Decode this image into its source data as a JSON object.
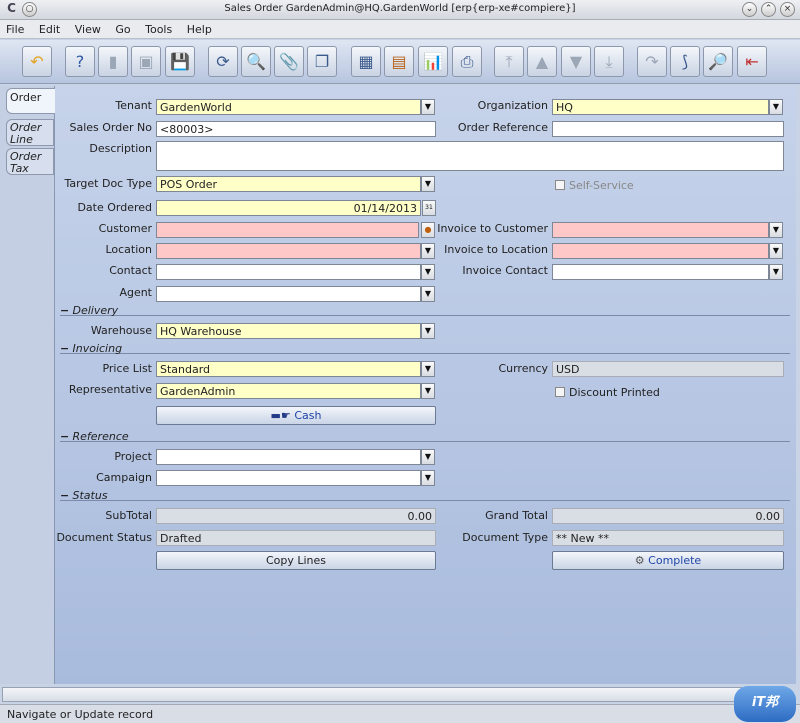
{
  "window": {
    "title": "Sales Order  GardenAdmin@HQ.GardenWorld [erp{erp-xe#compiere}]"
  },
  "menu": [
    "File",
    "Edit",
    "View",
    "Go",
    "Tools",
    "Help"
  ],
  "tabs": {
    "order": "Order",
    "order_line_1": "Order",
    "order_line_2": "Line",
    "order_tax_1": "Order",
    "order_tax_2": "Tax"
  },
  "form": {
    "tenant_label": "Tenant",
    "tenant_value": "GardenWorld",
    "org_label": "Organization",
    "org_value": "HQ",
    "so_label": "Sales Order No",
    "so_value": "<80003>",
    "order_ref_label": "Order Reference",
    "order_ref_value": "",
    "desc_label": "Description",
    "desc_value": "",
    "target_label": "Target Doc Type",
    "target_value": "POS Order",
    "self_service_label": "Self-Service",
    "date_label": "Date Ordered",
    "date_value": "01/14/2013",
    "date_btn": "31",
    "customer_label": "Customer",
    "customer_value": "",
    "inv_customer_label": "Invoice to Customer",
    "inv_customer_value": "",
    "location_label": "Location",
    "location_value": "",
    "inv_location_label": "Invoice to Location",
    "inv_location_value": "",
    "contact_label": "Contact",
    "contact_value": "",
    "inv_contact_label": "Invoice Contact",
    "inv_contact_value": "",
    "agent_label": "Agent",
    "agent_value": ""
  },
  "sections": {
    "delivery": "Delivery",
    "invoicing": "Invoicing",
    "reference": "Reference",
    "status": "Status"
  },
  "delivery": {
    "warehouse_label": "Warehouse",
    "warehouse_value": "HQ Warehouse"
  },
  "invoicing": {
    "pricelist_label": "Price List",
    "pricelist_value": "Standard",
    "currency_label": "Currency",
    "currency_value": "USD",
    "rep_label": "Representative",
    "rep_value": "GardenAdmin",
    "discount_label": "Discount Printed",
    "cash_button": "Cash"
  },
  "reference": {
    "project_label": "Project",
    "project_value": "",
    "campaign_label": "Campaign",
    "campaign_value": ""
  },
  "status": {
    "subtotal_label": "SubTotal",
    "subtotal_value": "0.00",
    "grandtotal_label": "Grand Total",
    "grandtotal_value": "0.00",
    "docstatus_label": "Document Status",
    "docstatus_value": "Drafted",
    "doctype_label": "Document Type",
    "doctype_value": "** New **",
    "copy_button": "Copy Lines",
    "complete_button": "Complete"
  },
  "statusbar": {
    "text": "Navigate or Update record"
  },
  "logo": {
    "text": "iT邦"
  }
}
